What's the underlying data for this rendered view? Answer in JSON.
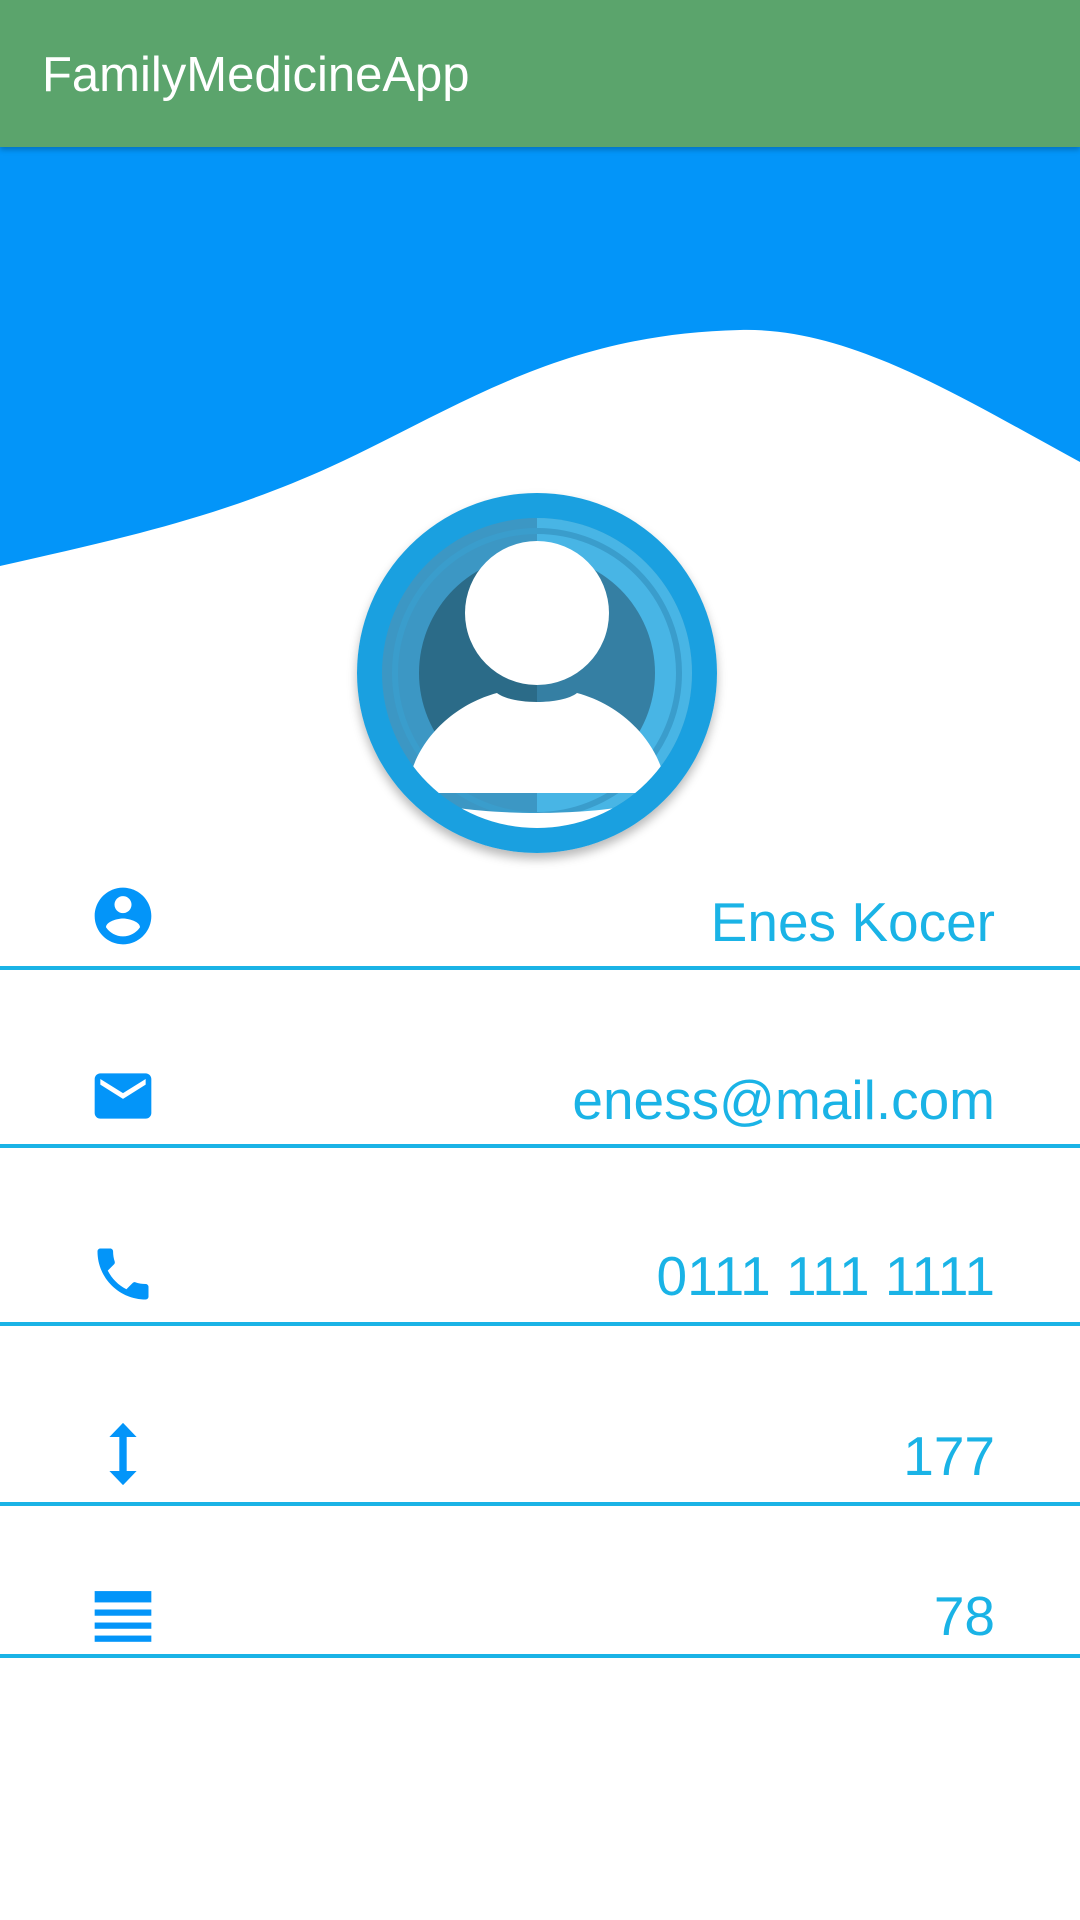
{
  "app_bar": {
    "title": "FamilyMedicineApp",
    "color": "#5ba46c"
  },
  "header": {
    "wave_color": "#0395f9"
  },
  "avatar": {
    "icon": "user-avatar-icon",
    "ring_color": "#1aa0e0"
  },
  "profile": {
    "accent_color": "#1ab3e6",
    "fields": [
      {
        "icon": "account-circle-icon",
        "value": "Enes Kocer"
      },
      {
        "icon": "email-icon",
        "value": "eness@mail.com"
      },
      {
        "icon": "phone-icon",
        "value": "0111 111 1111"
      },
      {
        "icon": "height-arrows-icon",
        "value": "177"
      },
      {
        "icon": "weight-lines-icon",
        "value": "78"
      }
    ]
  }
}
